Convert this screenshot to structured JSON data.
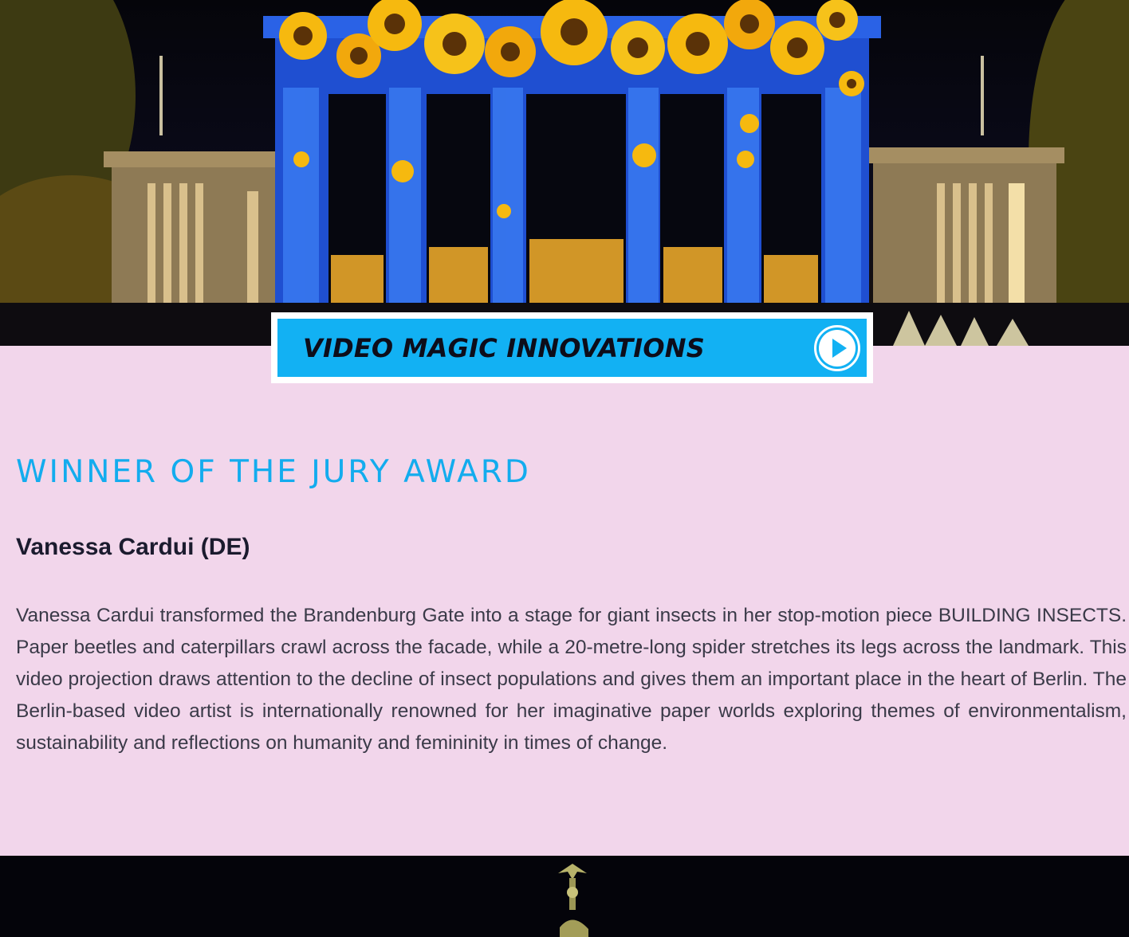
{
  "hero": {
    "image_alt": "Brandenburg Gate illuminated with sunflower video projection",
    "colors": {
      "projection_blue": "#1f4fd1",
      "sunflower": "#f6b90f",
      "night_sky": "#05050a"
    }
  },
  "video_banner": {
    "title": "VIDEO MAGIC INNOVATIONS",
    "play_icon": "play-icon",
    "accent_color": "#12b1f3"
  },
  "award": {
    "heading": "WINNER OF THE JURY AWARD",
    "artist": "Vanessa Cardui (DE)",
    "description": "Vanessa Cardui transformed the Brandenburg Gate into a stage for giant insects in her stop-motion piece BUILDING INSECTS. Paper beetles and caterpillars crawl across the facade, while a 20-metre-long spider stretches its legs across the landmark. This video projection draws attention to the decline of insect populations and gives them an important place in the heart of Berlin. The Berlin-based video artist is internationally renowned for her imaginative paper worlds exploring themes of environmentalism, sustainability and reflections on humanity and femininity in times of change."
  },
  "bottom_photo": {
    "image_alt": "Quadriga statue on top of the Brandenburg Gate at night"
  }
}
